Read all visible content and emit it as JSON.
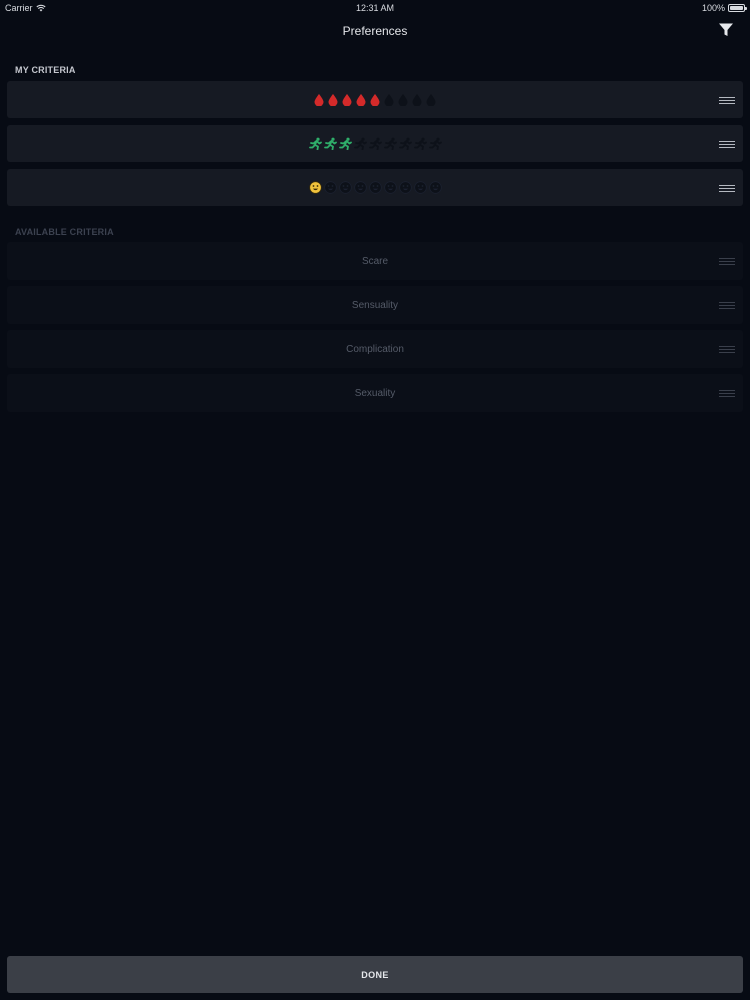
{
  "status_bar": {
    "carrier": "Carrier",
    "time": "12:31 AM",
    "battery": "100%"
  },
  "nav": {
    "title": "Preferences",
    "filter_icon": "filter-icon"
  },
  "my_criteria": {
    "header": "MY CRITERIA",
    "rows": [
      {
        "icon": "blood-drop-icon",
        "active_color": "#d42a2a",
        "inactive_color": "#0d1119",
        "rating": 5,
        "max": 9
      },
      {
        "icon": "runner-icon",
        "active_color": "#2fae6a",
        "inactive_color": "#0d1119",
        "rating": 3,
        "max": 9
      },
      {
        "icon": "smiley-face-icon",
        "active_color": "#f0c23c",
        "inactive_color": "#0d1119",
        "rating": 1,
        "max": 9
      }
    ]
  },
  "available_criteria": {
    "header": "AVAILABLE CRITERIA",
    "items": [
      "Scare",
      "Sensuality",
      "Complication",
      "Sexuality"
    ]
  },
  "done_label": "DONE"
}
